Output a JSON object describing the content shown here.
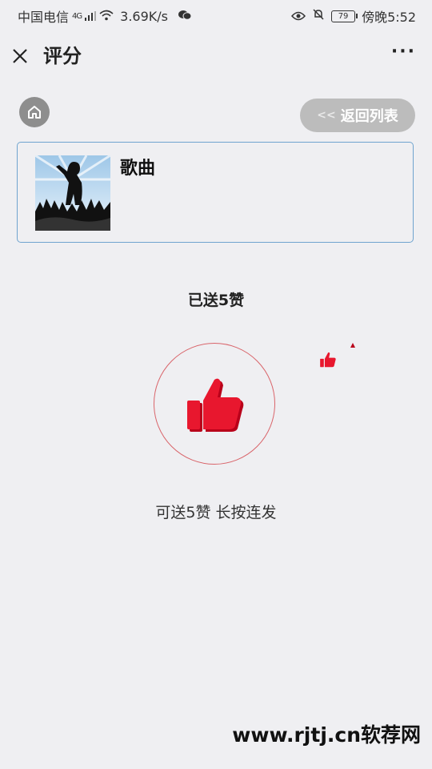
{
  "status_bar": {
    "carrier": "中国电信",
    "network": "4G",
    "speed": "3.69K/s",
    "battery": "79",
    "time": "傍晚5:52"
  },
  "nav": {
    "title": "评分",
    "more": "···"
  },
  "header": {
    "back_label": "返回列表",
    "back_arrows": "<<"
  },
  "song": {
    "title": "歌曲"
  },
  "like": {
    "sent_text": "已送5赞",
    "hint_text": "可送5赞 长按连发",
    "color": "#e8172e"
  },
  "watermark": "www.rjtj.cn软荐网"
}
